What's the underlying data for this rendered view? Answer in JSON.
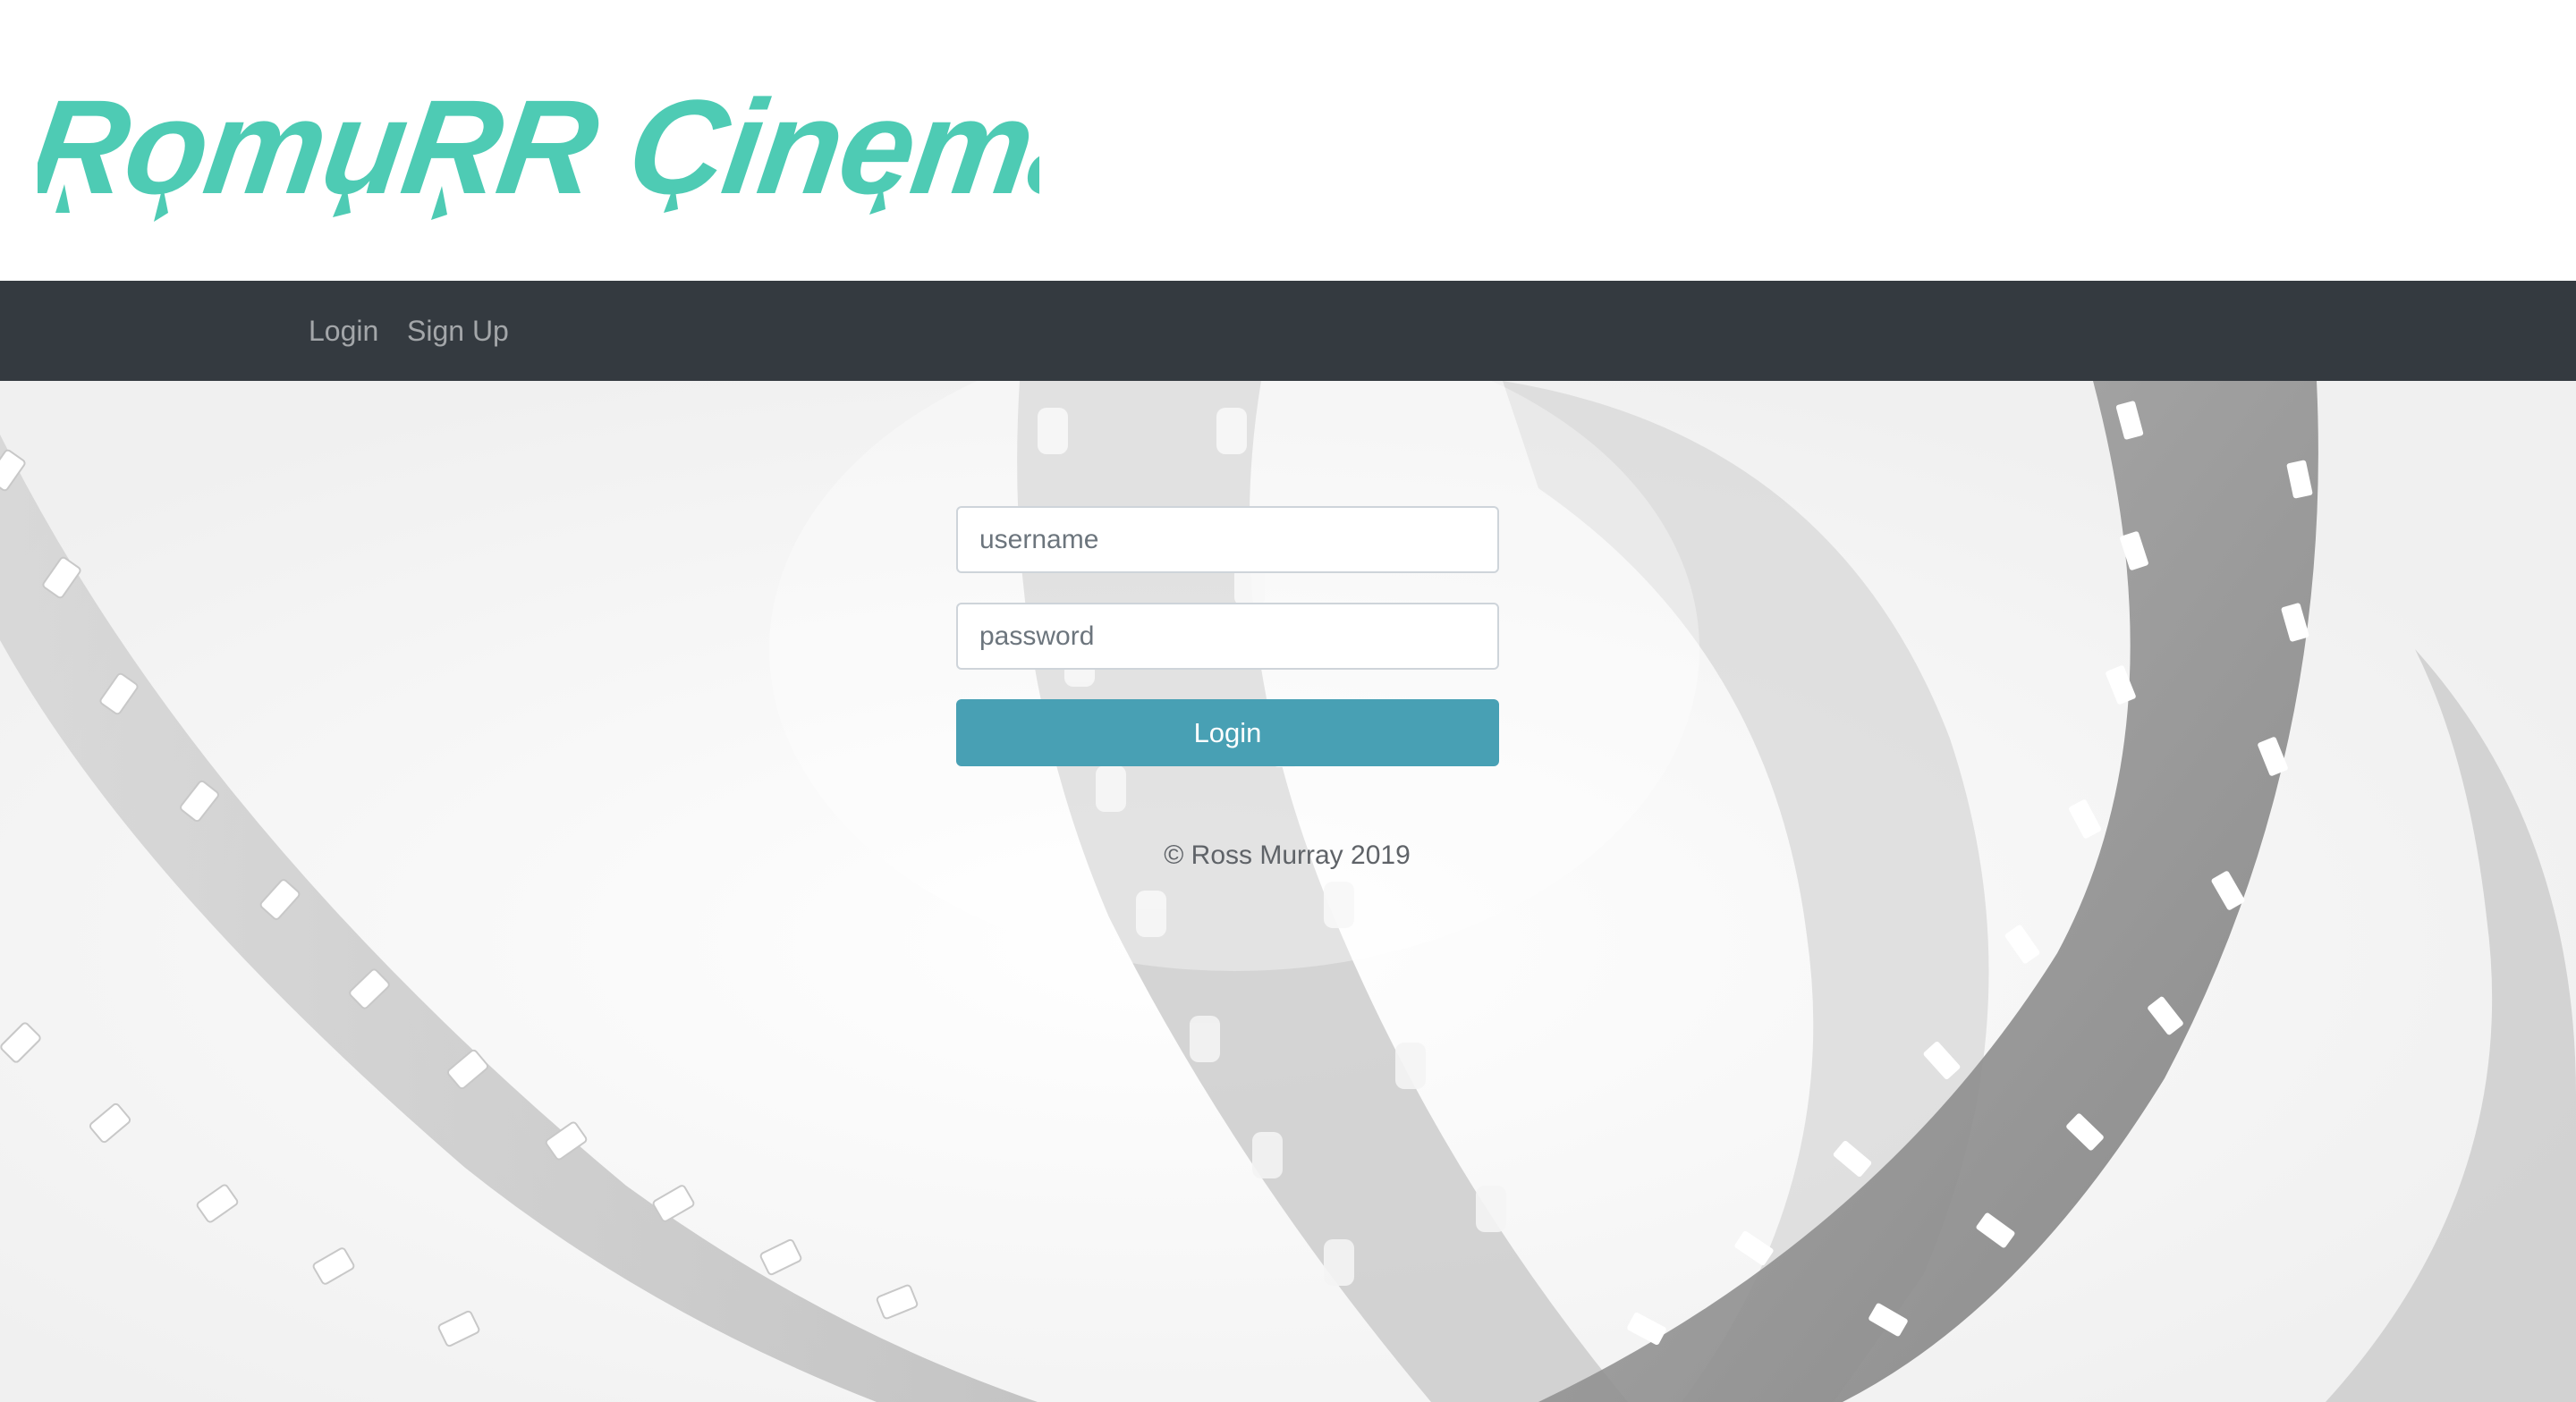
{
  "brand": {
    "name": "RomuRR Cinemas",
    "color": "#4ecbb4"
  },
  "nav": {
    "items": [
      {
        "label": "Login"
      },
      {
        "label": "Sign Up"
      }
    ],
    "background": "#343a40"
  },
  "login_form": {
    "username_placeholder": "username",
    "password_placeholder": "password",
    "submit_label": "Login",
    "button_color": "#48a0b4"
  },
  "footer": {
    "copyright": "© Ross Murray 2019"
  },
  "background_image": {
    "icon": "film-strip-photo"
  }
}
